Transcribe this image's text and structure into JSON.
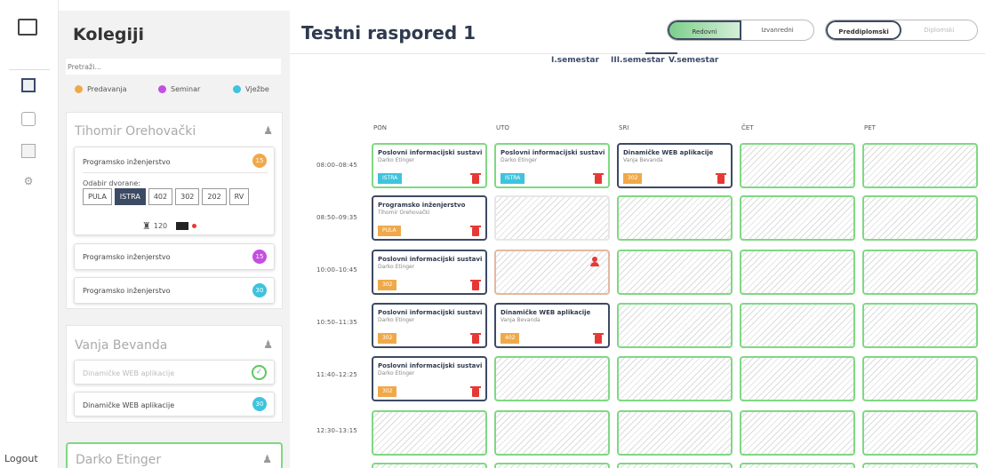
{
  "nav": {
    "logout": "Logout"
  },
  "panel": {
    "title": "Kolegiji",
    "search_placeholder": "Pretraži...",
    "legend": [
      {
        "label": "Predavanja",
        "color": "#f0a94a"
      },
      {
        "label": "Seminar",
        "color": "#c44fe0"
      },
      {
        "label": "Vježbe",
        "color": "#3fc3de"
      }
    ],
    "teachers": [
      {
        "name": "Tihomir Orehovački",
        "courses": [
          {
            "name": "Programsko inženjerstvo",
            "badge": "15",
            "color": "#f0a94a"
          },
          {
            "name": "Programsko inženjerstvo",
            "badge": "15",
            "color": "#c44fe0"
          },
          {
            "name": "Programsko inženjerstvo",
            "badge": "30",
            "color": "#3fc3de"
          }
        ],
        "room_label": "Odabir dvorane:",
        "rooms": [
          "PULA",
          "ISTRA",
          "402",
          "302",
          "202",
          "RV"
        ],
        "selected_room": "ISTRA",
        "capacity": "120"
      },
      {
        "name": "Vanja Bevanda",
        "courses": [
          {
            "name": "Dinamičke WEB aplikacije",
            "check": "✓"
          },
          {
            "name": "Dinamičke WEB aplikacije",
            "badge": "30",
            "color": "#3fc3de"
          }
        ]
      },
      {
        "name": "Darko Etinger"
      }
    ]
  },
  "main": {
    "title": "Testni raspored 1",
    "toggle1": [
      "Redovni",
      "Izvanredni"
    ],
    "toggle2": [
      "Preddiplomski",
      "Diplomski"
    ],
    "semesters": [
      "I.semestar",
      "III.semestar",
      "V.semestar"
    ],
    "days": [
      "PON",
      "UTO",
      "SRI",
      "ČET",
      "PET"
    ],
    "times": [
      "08:00–08:45",
      "08:50–09:35",
      "10:00–10:45",
      "10:50–11:35",
      "11:40–12:25",
      "12:30–13:15"
    ],
    "slots": {
      "s1": {
        "name": "Poslovni informacijski sustavi",
        "prof": "Darko Etinger",
        "room": "ISTRA",
        "color": "#3fc3de"
      },
      "s2": {
        "name": "Poslovni informacijski sustavi",
        "prof": "Darko Etinger",
        "room": "ISTRA",
        "color": "#3fc3de"
      },
      "s3": {
        "name": "Dinamičke WEB aplikacije",
        "prof": "Vanja Bevanda",
        "room": "302",
        "color": "#f0a94a"
      },
      "s4": {
        "name": "Programsko inženjerstvo",
        "prof": "Tihomir Orehovački",
        "room": "PULA",
        "color": "#f0a94a"
      },
      "s5": {
        "name": "Poslovni informacijski sustavi",
        "prof": "Darko Etinger",
        "room": "302",
        "color": "#f0a94a"
      },
      "s6": {
        "name": "Poslovni informacijski sustavi",
        "prof": "Darko Etinger",
        "room": "302",
        "color": "#f0a94a"
      },
      "s7": {
        "name": "Dinamičke WEB aplikacije",
        "prof": "Vanja Bevanda",
        "room": "402",
        "color": "#f0a94a"
      },
      "s8": {
        "name": "Poslovni informacijski sustavi",
        "prof": "Darko Etinger",
        "room": "302",
        "color": "#f0a94a"
      }
    }
  }
}
